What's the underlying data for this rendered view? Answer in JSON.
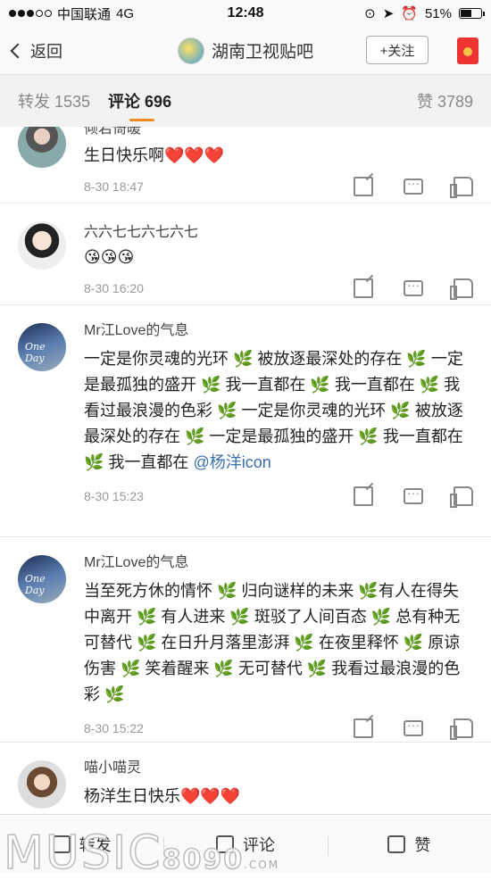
{
  "status": {
    "carrier": "中国联通",
    "network": "4G",
    "time": "12:48",
    "battery": "51%"
  },
  "nav": {
    "back": "返回",
    "title": "湖南卫视贴吧",
    "follow": "+关注"
  },
  "tabs": {
    "reposts": "转发 1535",
    "comments": "评论 696",
    "likes": "赞 3789"
  },
  "comments": [
    {
      "user": "倾若倚暖",
      "text": "生日快乐啊❤️❤️❤️",
      "time": "8-30 18:47"
    },
    {
      "user": "六六七七六七六七",
      "text": "😘😘😘",
      "time": "8-30 16:20"
    },
    {
      "user": "Mr江Love的气息",
      "text": "一定是你灵魂的光环 🌿 被放逐最深处的存在 🌿 一定是最孤独的盛开 🌿 我一直都在 🌿 我一直都在 🌿 我看过最浪漫的色彩 🌿 一定是你灵魂的光环 🌿 被放逐最深处的存在 🌿 一定是最孤独的盛开 🌿 我一直都在 🌿 我一直都在",
      "mention": "@杨洋icon",
      "avatar_text": "One Day",
      "time": "8-30 15:23"
    },
    {
      "user": "Mr江Love的气息",
      "text": "当至死方休的情怀 🌿 归向谜样的未来 🌿有人在得失中离开 🌿 有人进来 🌿 斑驳了人间百态 🌿 总有种无可替代 🌿 在日升月落里澎湃 🌿 在夜里释怀 🌿 原谅伤害 🌿 笑着醒来 🌿 无可替代 🌿 我看过最浪漫的色彩 🌿",
      "avatar_text": "One Day",
      "time": "8-30 15:22"
    },
    {
      "user": "喵小喵灵",
      "text": "杨洋生日快乐❤️❤️❤️",
      "time": ""
    }
  ],
  "toolbar": {
    "repost": "转发",
    "comment": "评论",
    "like": "赞"
  },
  "watermark": {
    "brand": "MUSIC",
    "num": "8090",
    "suffix": ".COM"
  }
}
